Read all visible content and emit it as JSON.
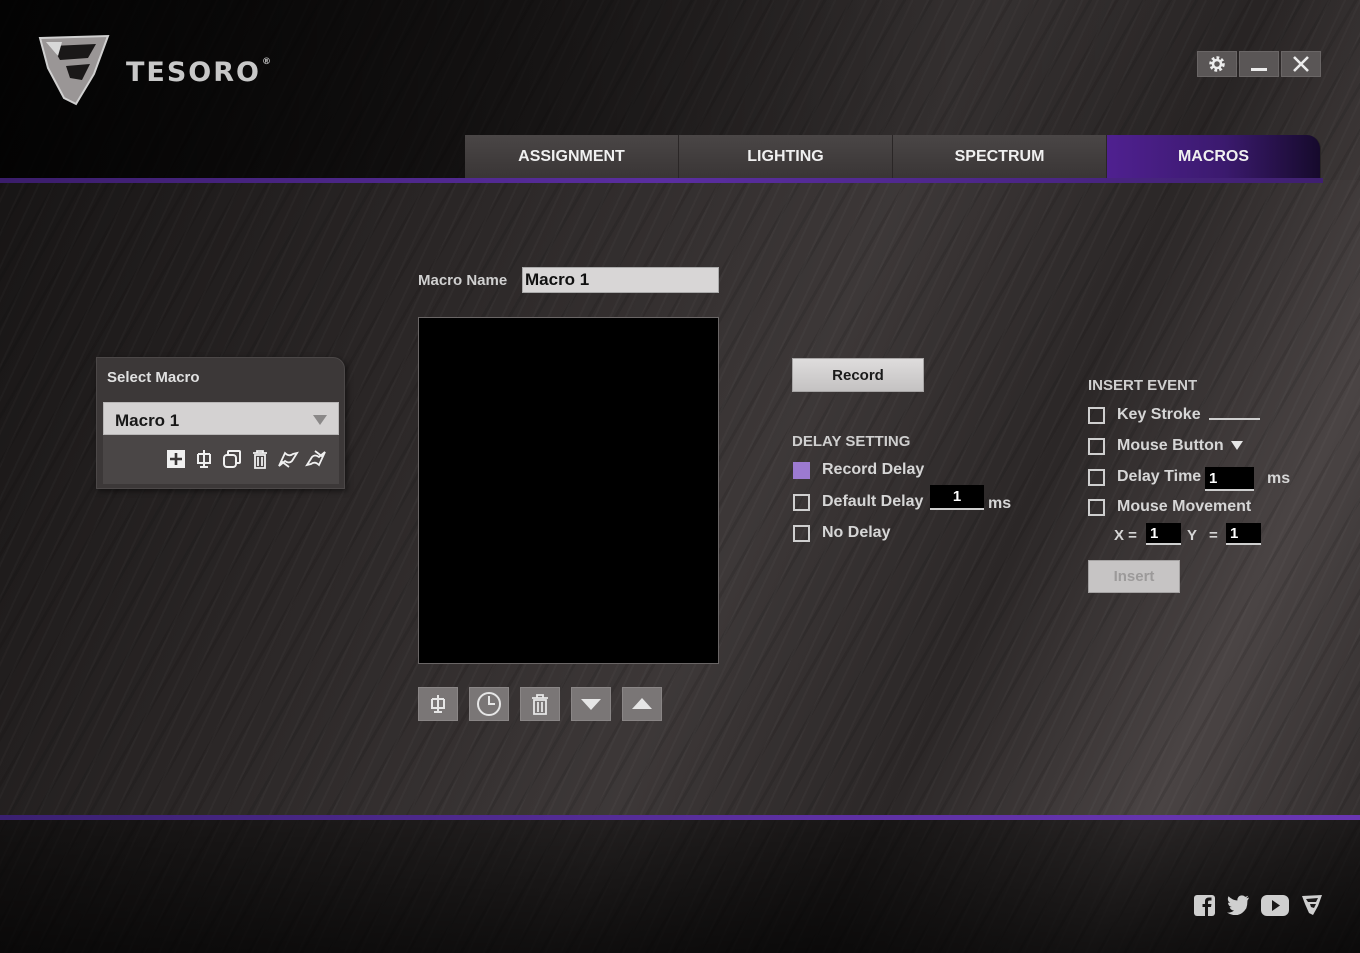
{
  "app": {
    "brand": "TESORO",
    "brand_mark": "®",
    "window_controls": {
      "settings_icon": "gear-icon",
      "minimize_icon": "minimize-icon",
      "close_icon": "close-icon"
    }
  },
  "tabs": [
    {
      "label": "ASSIGNMENT",
      "active": false
    },
    {
      "label": "LIGHTING",
      "active": false
    },
    {
      "label": "SPECTRUM",
      "active": false
    },
    {
      "label": "MACROS",
      "active": true
    }
  ],
  "select_macro": {
    "title": "Select Macro",
    "selected": "Macro 1",
    "tools": [
      "add-icon",
      "record-macro-icon",
      "copy-icon",
      "delete-icon",
      "import-icon",
      "export-icon"
    ]
  },
  "macro_editor": {
    "name_label": "Macro Name",
    "name_value": "Macro 1",
    "list_tools": [
      "insert-icon",
      "clock-icon",
      "trash-icon",
      "move-down-icon",
      "move-up-icon"
    ]
  },
  "record": {
    "label": "Record"
  },
  "delay_setting": {
    "title": "DELAY SETTING",
    "record_delay": {
      "label": "Record Delay",
      "checked": true
    },
    "default_delay": {
      "label": "Default Delay",
      "checked": false,
      "value": "1",
      "unit": "ms"
    },
    "no_delay": {
      "label": "No Delay",
      "checked": false
    }
  },
  "insert_event": {
    "title": "INSERT EVENT",
    "key_stroke": {
      "label": "Key Stroke",
      "checked": false
    },
    "mouse_button": {
      "label": "Mouse Button",
      "checked": false
    },
    "delay_time": {
      "label": "Delay Time",
      "checked": false,
      "value": "1",
      "unit": "ms"
    },
    "mouse_movement": {
      "label": "Mouse Movement",
      "checked": false
    },
    "x_label": "X =",
    "x_value": "1",
    "y_label": "Y",
    "y_eq": "=",
    "y_value": "1",
    "insert_label": "Insert"
  },
  "social": [
    "facebook-icon",
    "twitter-icon",
    "youtube-icon",
    "tesoro-icon"
  ],
  "colors": {
    "accent": "#5a2ea0",
    "checked": "#9c7ad0"
  }
}
